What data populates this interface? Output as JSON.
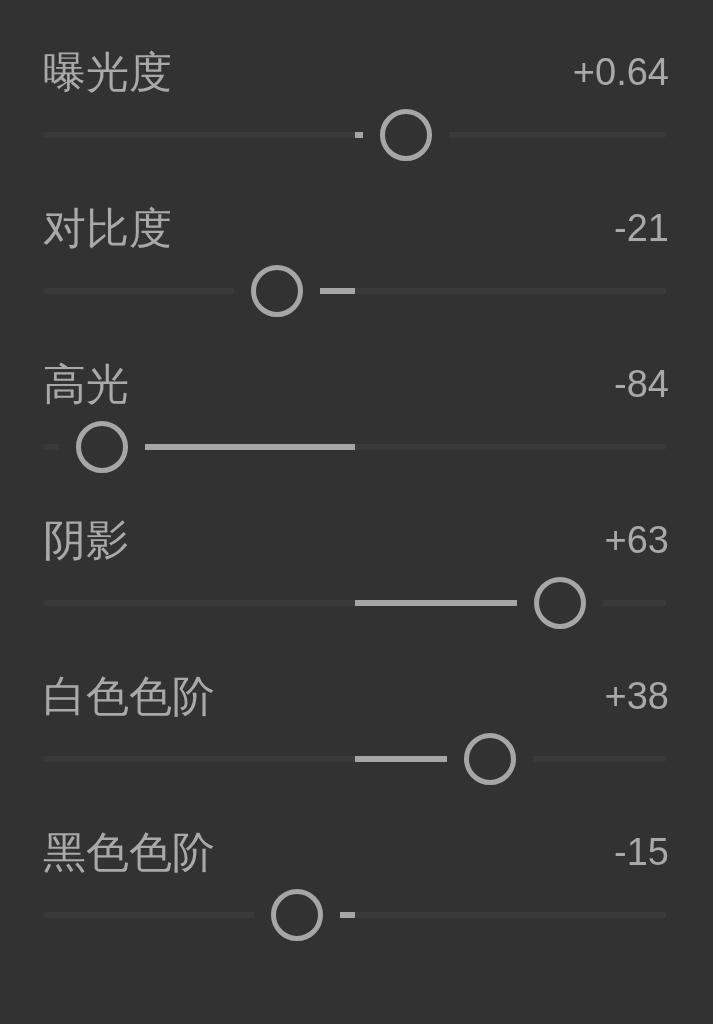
{
  "sliders": [
    {
      "label": "曝光度",
      "value": "+0.64",
      "level": 0.582
    },
    {
      "label": "对比度",
      "value": "-21",
      "level": 0.376
    },
    {
      "label": "高光",
      "value": "-84",
      "level": 0.095
    },
    {
      "label": "阴影",
      "value": "+63",
      "level": 0.83
    },
    {
      "label": "白色色阶",
      "value": "+38",
      "level": 0.717
    },
    {
      "label": "黑色色阶",
      "value": "-15",
      "level": 0.408
    }
  ]
}
